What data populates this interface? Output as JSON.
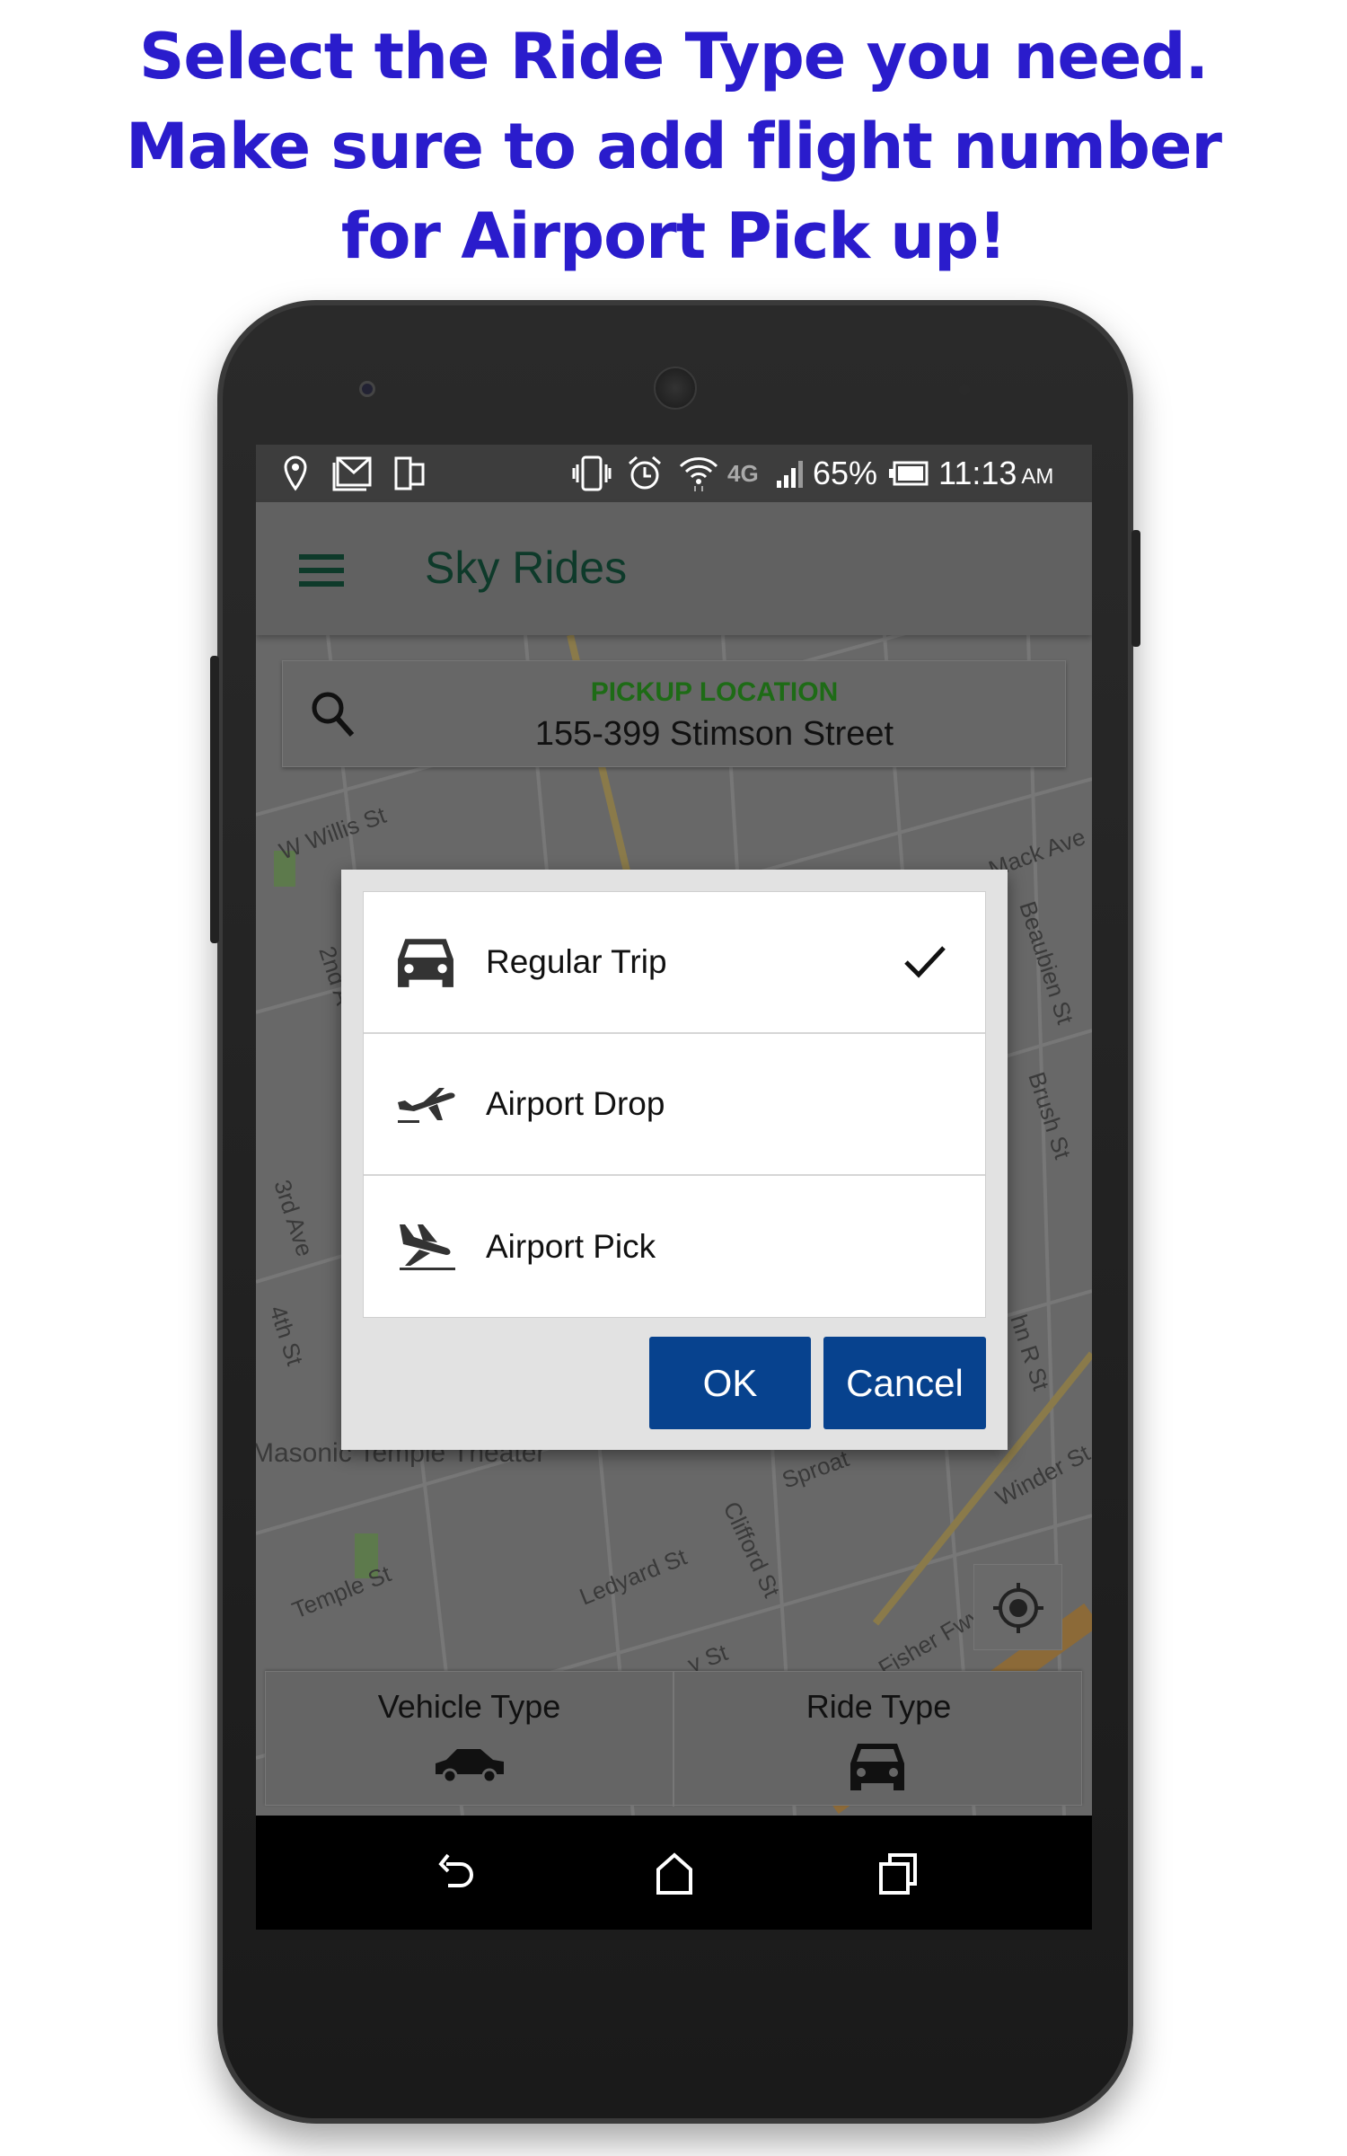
{
  "headline": {
    "lines": [
      "Select the Ride Type you need.",
      "Make sure to add flight number",
      "for Airport Pick up!"
    ],
    "color": "#2a1ccc"
  },
  "status_bar": {
    "left_icons": [
      "location-pin-icon",
      "gmail-icon",
      "device-icon"
    ],
    "right_icons": [
      "vibrate-icon",
      "alarm-icon",
      "wifi-icon",
      "4g-icon",
      "signal-icon",
      "battery-icon"
    ],
    "network": "4G",
    "battery": "65%",
    "time": "11:13",
    "ampm": "AM"
  },
  "toolbar": {
    "menu_icon": "hamburger-menu-icon",
    "title": "Sky Rides",
    "title_color": "#0e3a2a"
  },
  "search": {
    "label": "PICKUP LOCATION",
    "label_color": "#1e6b16",
    "value": "155-399 Stimson Street",
    "icon": "search-icon"
  },
  "map": {
    "labels": [
      "W Willis St",
      "Mack Ave",
      "Beaubien St",
      "2nd A",
      "Brush St",
      "3rd Ave",
      "4th St",
      "hn R St",
      "Masonic Temple Theater",
      "Sproat",
      "Winder St",
      "Temple St",
      "Ledyard St",
      "Clifford St",
      "Fisher Fwy",
      "y St"
    ]
  },
  "dialog": {
    "options": [
      {
        "label": "Regular Trip",
        "icon": "car-front-icon",
        "selected": true
      },
      {
        "label": "Airport Drop",
        "icon": "airplane-takeoff-icon",
        "selected": false
      },
      {
        "label": "Airport Pick",
        "icon": "airplane-landing-icon",
        "selected": false
      }
    ],
    "ok_label": "OK",
    "cancel_label": "Cancel",
    "button_color": "#07428e"
  },
  "bottom_panel": {
    "vehicle_type": "Vehicle Type",
    "ride_type": "Ride Type"
  },
  "nav_bar": {
    "icons": [
      "back-icon",
      "home-icon",
      "recent-apps-icon"
    ]
  }
}
